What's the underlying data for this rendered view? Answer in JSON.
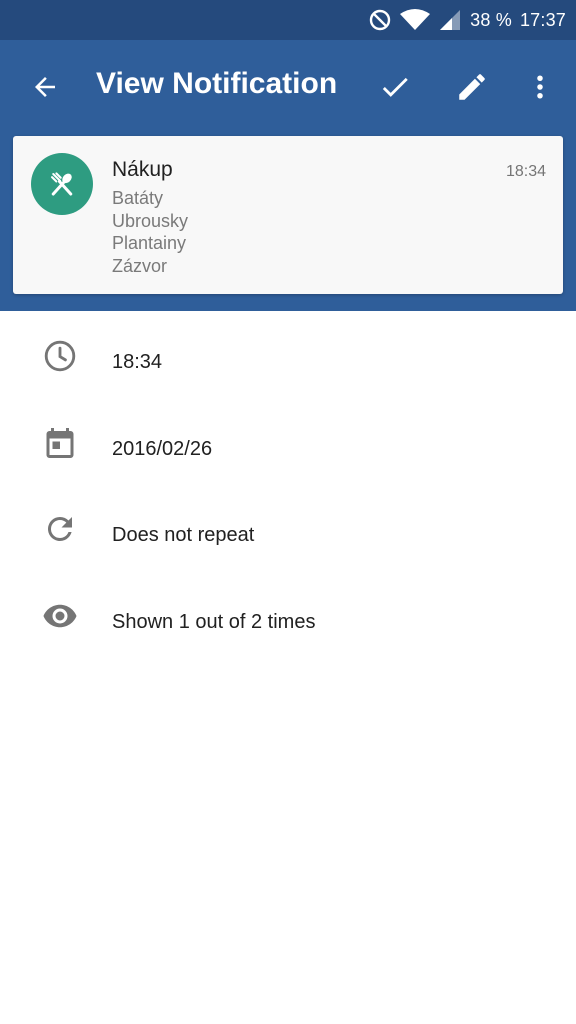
{
  "status_bar": {
    "battery": "38 %",
    "time": "17:37",
    "icons": [
      "do-not-disturb-icon",
      "wifi-icon",
      "cell-signal-icon"
    ]
  },
  "app_bar": {
    "title": "View Notification",
    "actions": [
      "check-icon",
      "edit-pencil-icon",
      "more-vert-icon"
    ]
  },
  "notification": {
    "title": "Nákup",
    "time": "18:34",
    "icon": "fork-spoon-icon",
    "icon_color": "#2e9c81",
    "lines": [
      "Batáty",
      "Ubrousky",
      "Plantainy",
      "Zázvor"
    ]
  },
  "details": {
    "time": "18:34",
    "date": "2016/02/26",
    "repeat": "Does not repeat",
    "shown": "Shown 1 out of 2 times"
  },
  "colors": {
    "primary": "#2f5e9a",
    "primary_dark": "#254a7d",
    "icon_gray": "#757575"
  }
}
